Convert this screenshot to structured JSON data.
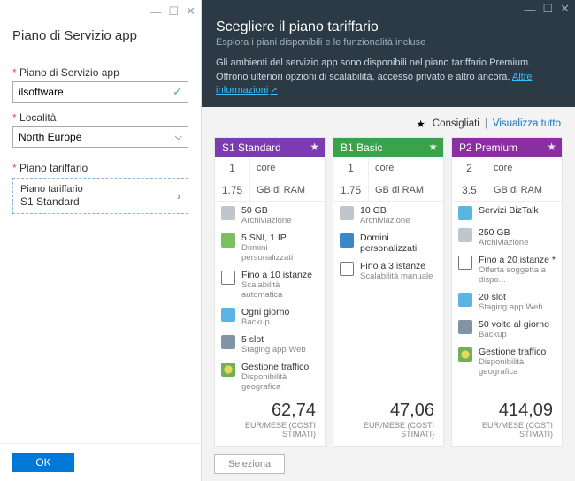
{
  "left": {
    "title": "Piano di Servizio app",
    "planLabel": "Piano di Servizio app",
    "planValue": "ilsoftware",
    "locLabel": "Località",
    "locValue": "North Europe",
    "tierLabel": "Piano tariffario",
    "tierValue": "S1 Standard",
    "ok": "OK"
  },
  "right": {
    "title": "Scegliere il piano tariffario",
    "sub": "Esplora i piani disponibili e le funzionalità incluse",
    "desc": "Gli ambienti del servizio app sono disponibili nel piano tariffario Premium. Offrono ulteriori opzioni di scalabilità, accesso privato e altro ancora.",
    "moreInfo": "Altre informazioni",
    "filters": {
      "rec": "Consigliati",
      "all": "Visualizza tutto"
    },
    "select": "Seleziona",
    "coreLabel": "core",
    "ramLabel": "GB di RAM",
    "priceLabel": "EUR/MESE (COSTI STIMATI)"
  },
  "cards": [
    {
      "name": "S1 Standard",
      "color": "#7a3cb0",
      "cores": "1",
      "ram": "1.75",
      "price": "62,74",
      "features": [
        {
          "ic": "i-db",
          "t": "50 GB",
          "s": "Archiviazione"
        },
        {
          "ic": "i-sh",
          "t": "5 SNI, 1 IP",
          "s": "Domini personalizzati"
        },
        {
          "ic": "i-scale",
          "t": "Fino a 10 istanze",
          "s": "Scalabilità automatica"
        },
        {
          "ic": "i-cloud",
          "t": "Ogni giorno",
          "s": "Backup"
        },
        {
          "ic": "i-slot",
          "t": "5 slot",
          "s": "Staging app Web"
        },
        {
          "ic": "i-geo",
          "t": "Gestione traffico",
          "s": "Disponibilità geografica"
        }
      ]
    },
    {
      "name": "B1 Basic",
      "color": "#3aa24a",
      "cores": "1",
      "ram": "1.75",
      "price": "47,06",
      "features": [
        {
          "ic": "i-db",
          "t": "10 GB",
          "s": "Archiviazione"
        },
        {
          "ic": "i-dom",
          "t": "Domini personalizzati",
          "s": ""
        },
        {
          "ic": "i-scale",
          "t": "Fino a 3 istanze",
          "s": "Scalabilità manuale"
        }
      ]
    },
    {
      "name": "P2 Premium",
      "color": "#8a2fa0",
      "cores": "2",
      "ram": "3.5",
      "price": "414,09",
      "features": [
        {
          "ic": "i-biz",
          "t": "Servizi BizTalk",
          "s": ""
        },
        {
          "ic": "i-db",
          "t": "250 GB",
          "s": "Archiviazione"
        },
        {
          "ic": "i-scale",
          "t": "Fino a 20 istanze *",
          "s": "Offerta soggetta a dispo..."
        },
        {
          "ic": "i-cloud",
          "t": "20 slot",
          "s": "Staging app Web"
        },
        {
          "ic": "i-slot",
          "t": "50 volte al giorno",
          "s": "Backup"
        },
        {
          "ic": "i-geo",
          "t": "Gestione traffico",
          "s": "Disponibilità geografica"
        }
      ]
    }
  ]
}
